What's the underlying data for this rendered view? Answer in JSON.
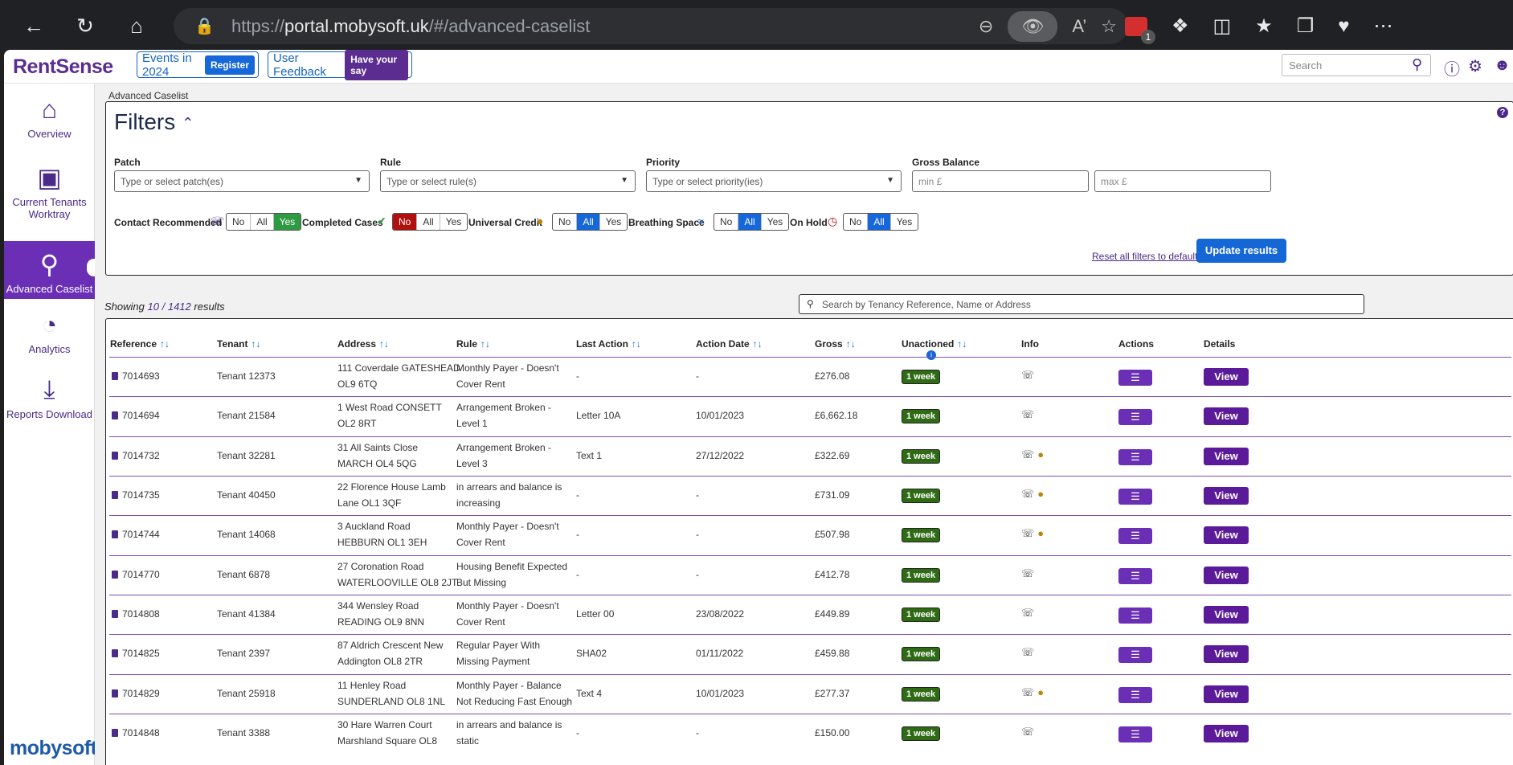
{
  "browser": {
    "url_prefix": "https://",
    "url_domain": "portal.mobysoft.uk",
    "url_path": "/#/advanced-caselist",
    "ext_badge": "1"
  },
  "header": {
    "logo": "RentSense",
    "promo1": {
      "text": "Events in 2024",
      "button": "Register"
    },
    "promo2": {
      "text": "User Feedback",
      "button": "Have your say"
    },
    "search_placeholder": "Search"
  },
  "sidebar": {
    "items": [
      {
        "label": "Overview",
        "icon": "home-icon"
      },
      {
        "label": "Current Tenants Worktray",
        "icon": "inbox-icon"
      },
      {
        "label": "Advanced Caselist",
        "icon": "search-icon"
      },
      {
        "label": "Analytics",
        "icon": "pie-chart-icon"
      },
      {
        "label": "Reports Download",
        "icon": "download-icon"
      }
    ],
    "footer_logo": "mobysoft"
  },
  "breadcrumb": "Advanced Caselist",
  "filters": {
    "title": "Filters",
    "patch": {
      "label": "Patch",
      "placeholder": "Type or select patch(es)"
    },
    "rule": {
      "label": "Rule",
      "placeholder": "Type or select rule(s)"
    },
    "priority": {
      "label": "Priority",
      "placeholder": "Type or select priority(ies)"
    },
    "gross": {
      "label": "Gross Balance",
      "min": "min £",
      "max": "max £"
    },
    "toggles": [
      {
        "label": "Contact Recommended",
        "selected": "Yes"
      },
      {
        "label": "Completed Cases",
        "selected": "No"
      },
      {
        "label": "Universal Credit",
        "selected": "All"
      },
      {
        "label": "Breathing Space",
        "selected": "All"
      },
      {
        "label": "On Hold",
        "selected": "All"
      }
    ],
    "opt_no": "No",
    "opt_all": "All",
    "opt_yes": "Yes",
    "reset": "Reset all filters to default",
    "update": "Update results"
  },
  "results": {
    "showing_prefix": "Showing",
    "shown": "10",
    "sep": "/",
    "total": "1412",
    "suffix": "results",
    "search_placeholder": "Search by Tenancy Reference, Name or Address"
  },
  "table": {
    "columns": {
      "reference": "Reference",
      "tenant": "Tenant",
      "address": "Address",
      "rule": "Rule",
      "last_action": "Last Action",
      "action_date": "Action Date",
      "gross": "Gross",
      "unactioned": "Unactioned",
      "info": "Info",
      "actions": "Actions",
      "details": "Details"
    },
    "sort_glyph": "↑↓",
    "view_label": "View",
    "rows": [
      {
        "ref": "7014693",
        "tenant": "Tenant 12373",
        "addr1": "111 Coverdale GATESHEAD",
        "addr2": "OL9 6TQ",
        "rule1": "Monthly Payer - Doesn't",
        "rule2": "Cover Rent",
        "last": "-",
        "date": "-",
        "gross": "£276.08",
        "unact": "1 week",
        "uc": false
      },
      {
        "ref": "7014694",
        "tenant": "Tenant 21584",
        "addr1": "1 West Road CONSETT",
        "addr2": "OL2 8RT",
        "rule1": "Arrangement Broken -",
        "rule2": "Level 1",
        "last": "Letter 10A",
        "date": "10/01/2023",
        "gross": "£6,662.18",
        "unact": "1 week",
        "uc": false
      },
      {
        "ref": "7014732",
        "tenant": "Tenant 32281",
        "addr1": "31 All Saints Close",
        "addr2": "MARCH OL4 5QG",
        "rule1": "Arrangement Broken -",
        "rule2": "Level 3",
        "last": "Text 1",
        "date": "27/12/2022",
        "gross": "£322.69",
        "unact": "1 week",
        "uc": true
      },
      {
        "ref": "7014735",
        "tenant": "Tenant 40450",
        "addr1": "22 Florence House Lamb",
        "addr2": "Lane OL1 3QF",
        "rule1": "in arrears and balance is",
        "rule2": "increasing",
        "last": "-",
        "date": "-",
        "gross": "£731.09",
        "unact": "1 week",
        "uc": true
      },
      {
        "ref": "7014744",
        "tenant": "Tenant 14068",
        "addr1": "3 Auckland Road",
        "addr2": "HEBBURN OL1 3EH",
        "rule1": "Monthly Payer - Doesn't",
        "rule2": "Cover Rent",
        "last": "-",
        "date": "-",
        "gross": "£507.98",
        "unact": "1 week",
        "uc": true
      },
      {
        "ref": "7014770",
        "tenant": "Tenant 6878",
        "addr1": "27 Coronation Road",
        "addr2": "WATERLOOVILLE OL8 2JT",
        "rule1": "Housing Benefit Expected",
        "rule2": "But Missing",
        "last": "-",
        "date": "-",
        "gross": "£412.78",
        "unact": "1 week",
        "uc": false
      },
      {
        "ref": "7014808",
        "tenant": "Tenant 41384",
        "addr1": "344 Wensley Road",
        "addr2": "READING OL9 8NN",
        "rule1": "Monthly Payer - Doesn't",
        "rule2": "Cover Rent",
        "last": "Letter 00",
        "date": "23/08/2022",
        "gross": "£449.89",
        "unact": "1 week",
        "uc": false
      },
      {
        "ref": "7014825",
        "tenant": "Tenant 2397",
        "addr1": "87 Aldrich Crescent New",
        "addr2": "Addington OL8 2TR",
        "rule1": "Regular Payer With",
        "rule2": "Missing Payment",
        "last": "SHA02",
        "date": "01/11/2022",
        "gross": "£459.88",
        "unact": "1 week",
        "uc": false
      },
      {
        "ref": "7014829",
        "tenant": "Tenant 25918",
        "addr1": "11 Henley Road",
        "addr2": "SUNDERLAND OL8 1NL",
        "rule1": "Monthly Payer - Balance",
        "rule2": "Not Reducing Fast Enough",
        "last": "Text 4",
        "date": "10/01/2023",
        "gross": "£277.37",
        "unact": "1 week",
        "uc": true
      },
      {
        "ref": "7014848",
        "tenant": "Tenant 3388",
        "addr1": "30 Hare Warren Court",
        "addr2": "Marshland Square OL8",
        "rule1": "in arrears and balance is",
        "rule2": "static",
        "last": "-",
        "date": "-",
        "gross": "£150.00",
        "unact": "1 week",
        "uc": false
      }
    ]
  }
}
